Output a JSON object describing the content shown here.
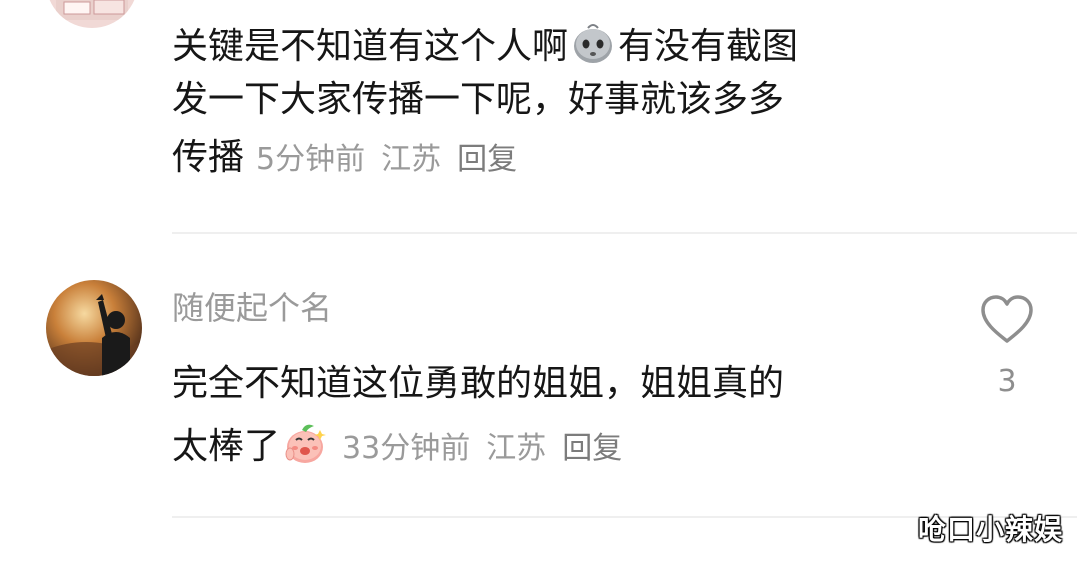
{
  "comments": [
    {
      "text_line1_a": "关键是不知道有这个人啊",
      "emoji1": "worried-blob-emoji",
      "text_line1_b": "有没有截图",
      "text_line2": "发一下大家传播一下呢，好事就该多多",
      "text_line3": "传播",
      "time": "5分钟前",
      "location": "江苏",
      "reply_label": "回复"
    },
    {
      "username": "随便起个名",
      "text_line1": "完全不知道这位勇敢的姐姐，姐姐真的",
      "text_line2": "太棒了",
      "emoji2": "peach-clap-emoji",
      "time": "33分钟前",
      "location": "江苏",
      "reply_label": "回复",
      "likes": "3",
      "like_icon": "heart-outline-icon"
    }
  ],
  "watermark": "呛口小辣娱",
  "colors": {
    "text": "#161616",
    "meta": "#9a9a9a",
    "divider": "#efefef",
    "icon": "#8e8e8e"
  }
}
